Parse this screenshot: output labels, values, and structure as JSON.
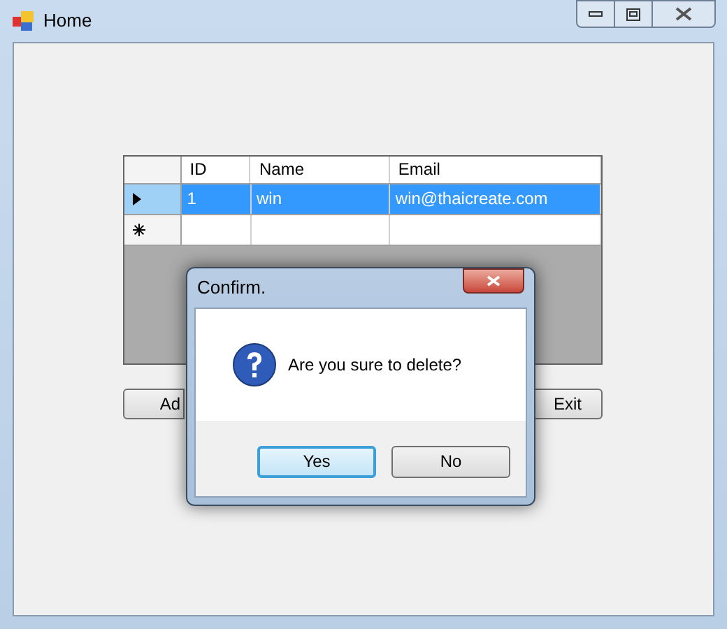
{
  "window": {
    "title": "Home"
  },
  "grid": {
    "columns": [
      "ID",
      "Name",
      "Email"
    ],
    "rows": [
      {
        "kind": "record",
        "selected": true,
        "cells": [
          "1",
          "win",
          "win@thaicreate.com"
        ]
      },
      {
        "kind": "new",
        "selected": false
      }
    ]
  },
  "buttons": [
    {
      "label": "Ad"
    },
    {
      "label": "Exit"
    }
  ],
  "dialog": {
    "title": "Confirm.",
    "message": "Are you sure to delete?",
    "buttons": [
      {
        "label": "Yes",
        "focused": true
      },
      {
        "label": "No",
        "focused": false
      }
    ]
  }
}
